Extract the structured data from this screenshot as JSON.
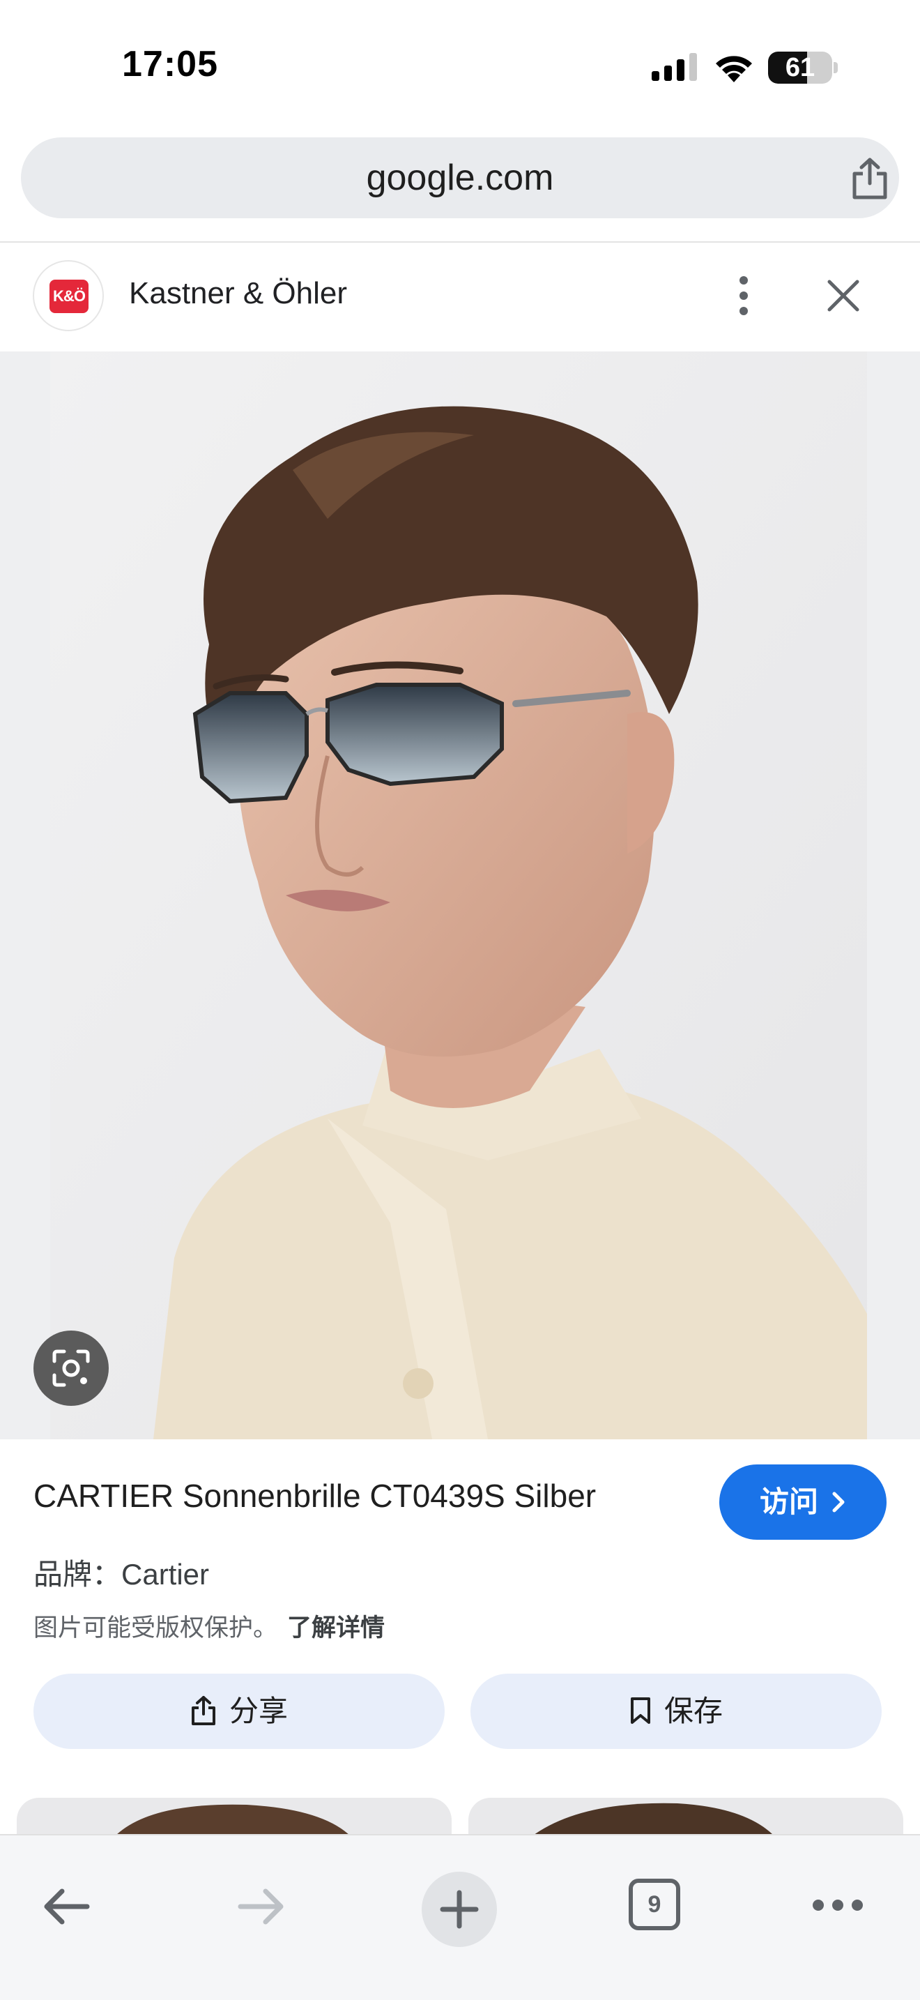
{
  "status_bar": {
    "time": "17:05",
    "battery": "61",
    "battery_level": 0.61
  },
  "address_bar": {
    "url": "google.com",
    "share_icon": "share-icon"
  },
  "source": {
    "name": "Kastner & Öhler",
    "logo_text": "K&Ö",
    "logo_color": "#e4283a",
    "more_icon": "more-vert-icon",
    "close_icon": "close-icon"
  },
  "image": {
    "lens_icon": "google-lens-icon"
  },
  "product": {
    "title": "CARTIER Sonnenbrille CT0439S Silber",
    "visit_label": "访问",
    "brand_line": "品牌：Cartier",
    "copyright_text": "图片可能受版权保护。",
    "learn_more": "了解详情",
    "share_label": "分享",
    "save_label": "保存"
  },
  "toolbar": {
    "tab_count": "9",
    "back_icon": "back-arrow-icon",
    "forward_icon": "forward-arrow-icon",
    "new_tab_icon": "plus-icon",
    "more_icon": "more-horiz-icon"
  },
  "colors": {
    "accent": "#1a73e8",
    "button_bg": "#e8eefa"
  }
}
